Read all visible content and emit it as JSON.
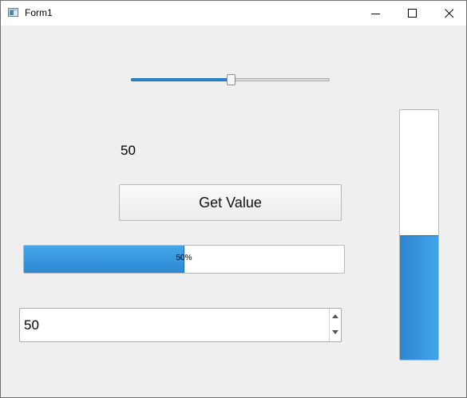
{
  "window": {
    "title": "Form1",
    "minimize_icon": "minimize-icon",
    "maximize_icon": "maximize-icon",
    "close_icon": "close-icon"
  },
  "slider": {
    "value": 50,
    "min": 0,
    "max": 100
  },
  "value_label": "50",
  "get_value_button": "Get Value",
  "horizontal_progress": {
    "value": 50,
    "text": "50%"
  },
  "spinbox": {
    "value": "50"
  },
  "vertical_progress": {
    "value": 50
  },
  "colors": {
    "accent": "#2f86cf",
    "window_bg": "#efefef"
  }
}
